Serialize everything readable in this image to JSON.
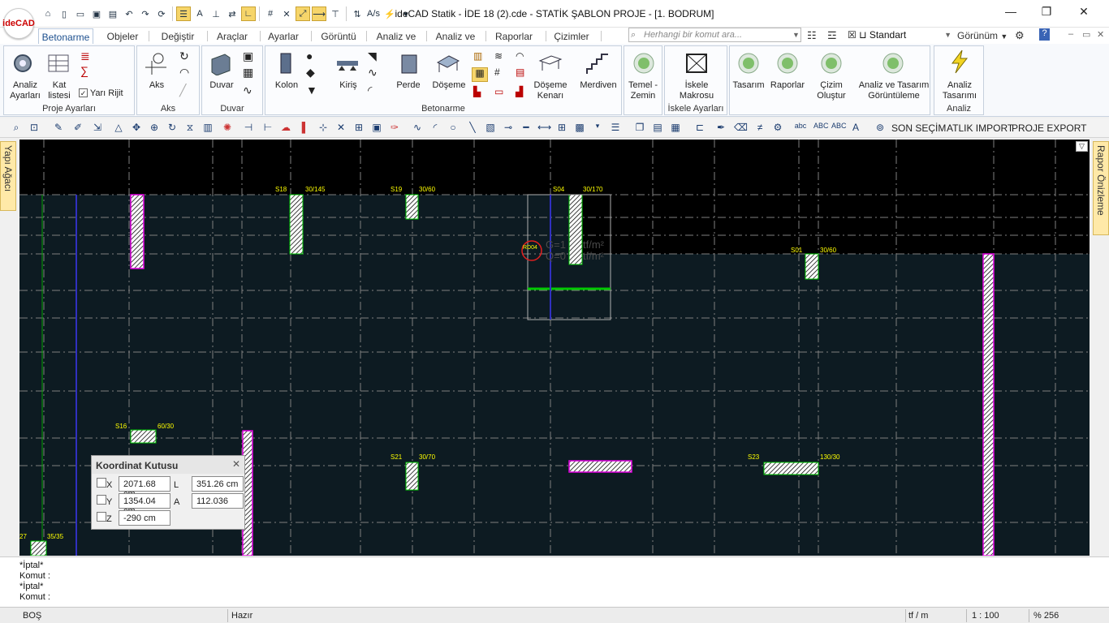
{
  "app": {
    "logo": "ideCAD",
    "title": "ideCAD Statik - İDE 18 (2).cde - STATİK ŞABLON PROJE - [1. BODRUM]",
    "window_buttons": [
      "minimize-icon",
      "restore-icon",
      "close-icon"
    ]
  },
  "tabs": [
    {
      "label": "Betonarme",
      "active": true
    },
    {
      "label": "Objeler"
    },
    {
      "label": "Değiştir"
    },
    {
      "label": "Araçlar"
    },
    {
      "label": "Ayarlar"
    },
    {
      "label": "Görüntü"
    },
    {
      "label": "Analiz ve Tas"
    },
    {
      "label": "Analiz ve Tas"
    },
    {
      "label": "Raporlar"
    },
    {
      "label": "Çizimler"
    }
  ],
  "search": {
    "placeholder": "Herhangi bir komut ara..."
  },
  "style_selector": {
    "value": "Standart"
  },
  "view_menu": {
    "label": "Görünüm"
  },
  "ribbon": {
    "proje_ayarlari": {
      "label": "Proje Ayarları",
      "analiz": "Analiz\nAyarları",
      "kat": "Kat\nlistesi",
      "yari_rijit": "Yarı Rijit",
      "yari_rijit_checked": true
    },
    "aks": {
      "label": "Aks",
      "btn": "Aks"
    },
    "duvar": {
      "label": "Duvar",
      "btn": "Duvar"
    },
    "betonarme": {
      "label": "Betonarme",
      "kolon": "Kolon",
      "kiris": "Kiriş",
      "perde": "Perde",
      "doseme": "Döşeme",
      "doseme_kenari": "Döşeme\nKenarı",
      "merdiven": "Merdiven"
    },
    "temel": {
      "btn": "Temel -\nZemin"
    },
    "iskele": {
      "label": "İskele Ayarları",
      "btn": "İskele\nMakrosu"
    },
    "tasarim": {
      "btn": "Tasarım"
    },
    "raporlar": {
      "btn": "Raporlar"
    },
    "cizim": {
      "btn": "Çizim\nOluştur"
    },
    "goruntuleme": {
      "btn": "Analiz ve Tasarım\nGörüntüleme"
    },
    "analiz": {
      "label": "Analiz",
      "btn": "Analiz\nTasarımı"
    }
  },
  "toolbar2": {
    "son_secim": "SON SEÇİM",
    "atlik_import": "ATLIK IMPORT",
    "proje_export": "PROJE EXPORT"
  },
  "side_panels": {
    "left": "Yapı Ağacı",
    "right": "Rapor Önizleme"
  },
  "canvas": {
    "column_labels": [
      {
        "name": "S18",
        "size": "30/145"
      },
      {
        "name": "S19",
        "size": "30/60"
      },
      {
        "name": "S04",
        "size": "30/170"
      },
      {
        "name": "S01",
        "size": "30/60"
      },
      {
        "name": "S16",
        "size": "60/30"
      },
      {
        "name": "S21",
        "size": "30/70"
      },
      {
        "name": "S23",
        "size": "130/30"
      },
      {
        "name": "27",
        "size": "35/35"
      }
    ],
    "slab_tag": "RD04",
    "load_text_1": "G=1",
    "load_text_2": "Q=0",
    "load_unit": "tf/m²"
  },
  "coord_box": {
    "title": "Koordinat Kutusu",
    "x_label": "X",
    "x_value": "2071.68 cm",
    "y_label": "Y",
    "y_value": "1354.04 cm",
    "z_label": "Z",
    "z_value": "-290 cm",
    "l_label": "L",
    "l_value": "351.26 cm",
    "a_label": "A",
    "a_value": "112.036"
  },
  "command_lines": [
    "*İptal*",
    "Komut :",
    "*İptal*",
    "Komut :"
  ],
  "status": {
    "left": "BOŞ",
    "mid": "Hazır",
    "unit": "tf / m",
    "scale": "1 : 100",
    "zoom": "% 256"
  },
  "colors": {
    "canvas_bg": "#000000",
    "slab_fill": "#0d1b22",
    "grid": "#7f7f7f",
    "column_yellow": "#ffff00",
    "beam_green": "#00c800",
    "wall_magenta": "#e000e0",
    "axis_blue": "#3030c0"
  }
}
